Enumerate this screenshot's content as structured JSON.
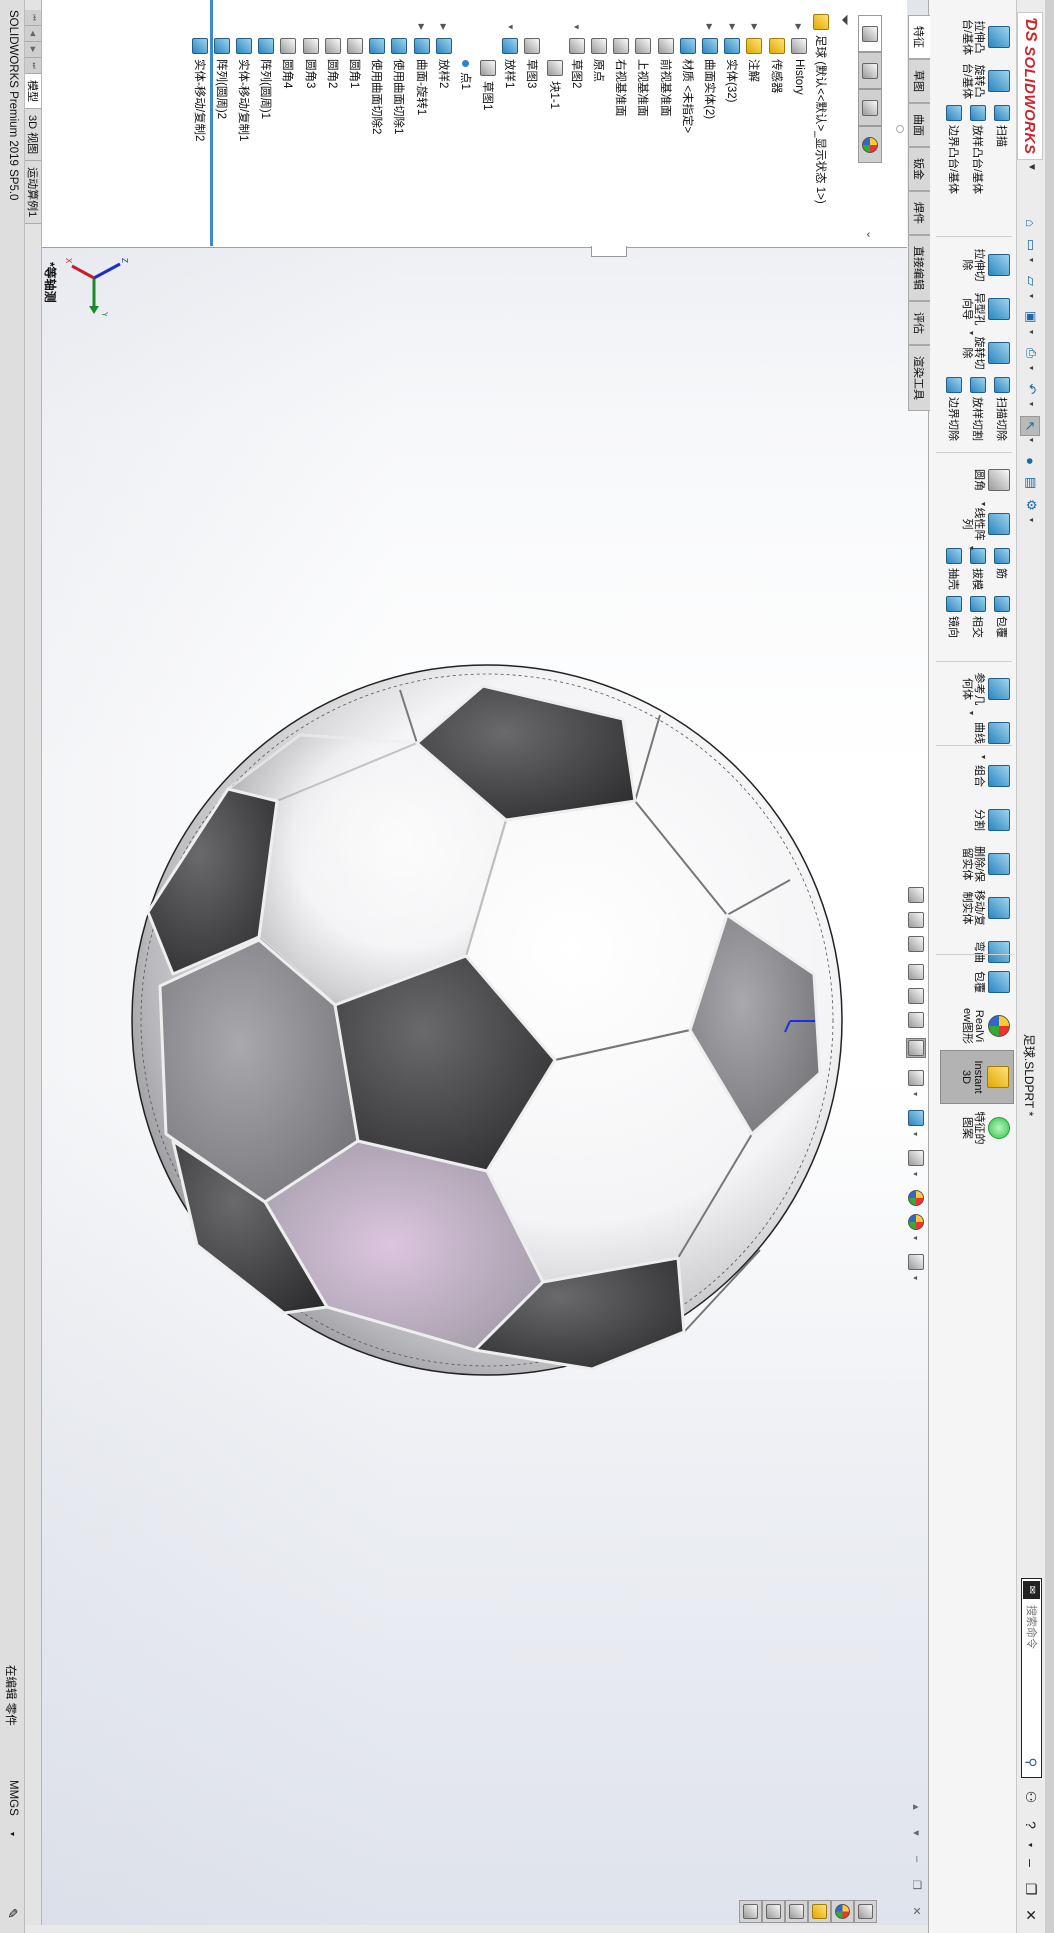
{
  "app": {
    "logo": "SOLIDWORKS",
    "title": "足球.SLDPRT *",
    "search_placeholder": "搜索命令",
    "status_product": "SOLIDWORKS Premium 2019 SP5.0",
    "status_mode": "在编辑 零件",
    "status_units": "MMGS",
    "view_name": "*等轴测"
  },
  "quick_access": [
    {
      "icon": "home-icon",
      "glyph": "⌂"
    },
    {
      "icon": "new-document-icon",
      "glyph": "▭",
      "dropdown": true
    },
    {
      "icon": "open-icon",
      "glyph": "▱",
      "dropdown": true
    },
    {
      "icon": "save-icon",
      "glyph": "▣",
      "dropdown": true
    },
    {
      "icon": "print-icon",
      "glyph": "⎙",
      "dropdown": true
    },
    {
      "icon": "undo-icon",
      "glyph": "↶",
      "dropdown": true
    },
    {
      "icon": "select-icon",
      "glyph": "↖",
      "dropdown": true,
      "selected": true
    },
    {
      "icon": "rebuild-icon",
      "glyph": "●"
    },
    {
      "icon": "file-properties-icon",
      "glyph": "▤"
    },
    {
      "icon": "options-gear-icon",
      "glyph": "⚙",
      "dropdown": true
    }
  ],
  "ribbon": {
    "groups": [
      {
        "items": [
          {
            "type": "large",
            "label": "拉伸凸台/基体",
            "icon": "extrude-boss-icon"
          },
          {
            "type": "large",
            "label": "旋转凸台/基体",
            "icon": "revolve-boss-icon"
          },
          {
            "type": "col",
            "items": [
              {
                "label": "扫描",
                "icon": "sweep-icon"
              },
              {
                "label": "放样凸台/基体",
                "icon": "loft-boss-icon"
              },
              {
                "label": "边界凸台/基体",
                "icon": "boundary-boss-icon"
              }
            ]
          }
        ]
      },
      {
        "items": [
          {
            "type": "large",
            "label": "拉伸切除",
            "icon": "extrude-cut-icon"
          },
          {
            "type": "large",
            "label": "异型孔向导",
            "icon": "hole-wizard-icon",
            "dropdown": true
          },
          {
            "type": "large",
            "label": "旋转切除",
            "icon": "revolve-cut-icon"
          },
          {
            "type": "col",
            "items": [
              {
                "label": "扫描切除",
                "icon": "swept-cut-icon"
              },
              {
                "label": "放样切割",
                "icon": "lofted-cut-icon"
              },
              {
                "label": "边界切除",
                "icon": "boundary-cut-icon"
              }
            ]
          }
        ]
      },
      {
        "items": [
          {
            "type": "large",
            "label": "圆角",
            "icon": "fillet-icon",
            "dropdown": true
          },
          {
            "type": "large",
            "label": "线性阵列",
            "icon": "linear-pattern-icon",
            "dropdown": true
          },
          {
            "type": "col",
            "items": [
              {
                "label": "筋",
                "icon": "rib-icon"
              },
              {
                "label": "拔模",
                "icon": "draft-icon"
              },
              {
                "label": "抽壳",
                "icon": "shell-icon"
              }
            ]
          },
          {
            "type": "col",
            "items": [
              {
                "label": "包覆",
                "icon": "wrap-icon"
              },
              {
                "label": "相交",
                "icon": "intersect-icon"
              },
              {
                "label": "镜向",
                "icon": "mirror-icon"
              }
            ]
          }
        ]
      },
      {
        "items": [
          {
            "type": "large",
            "label": "参考几何体",
            "icon": "reference-geometry-icon",
            "dropdown": true
          },
          {
            "type": "large",
            "label": "曲线",
            "icon": "curves-icon",
            "dropdown": true
          }
        ]
      },
      {
        "items": [
          {
            "type": "large",
            "label": "组合",
            "icon": "combine-icon"
          },
          {
            "type": "large",
            "label": "分割",
            "icon": "split-icon"
          },
          {
            "type": "large",
            "label": "删除/保留实体",
            "icon": "delete-keep-body-icon"
          },
          {
            "type": "large",
            "label": "移动/复制实体",
            "icon": "move-copy-body-icon"
          },
          {
            "type": "large",
            "label": "弯曲",
            "icon": "flex-icon"
          }
        ]
      },
      {
        "items": [
          {
            "type": "large",
            "label": "包覆",
            "icon": "wrap-icon"
          },
          {
            "type": "large",
            "label": "RealView图形",
            "icon": "realview-icon"
          },
          {
            "type": "large",
            "label": "Instant3D",
            "icon": "instant3d-icon",
            "active": true
          },
          {
            "type": "large",
            "label": "特征的图案",
            "icon": "feature-pattern-icon"
          }
        ]
      }
    ]
  },
  "command_tabs": [
    {
      "label": "特征",
      "active": true
    },
    {
      "label": "草图"
    },
    {
      "label": "曲面"
    },
    {
      "label": "钣金"
    },
    {
      "label": "焊件"
    },
    {
      "label": "直接编辑"
    },
    {
      "label": "评估"
    },
    {
      "label": "渲染工具"
    }
  ],
  "feature_manager": {
    "tabs": [
      {
        "icon": "featuremanager-tree-icon",
        "active": true
      },
      {
        "icon": "propertymanager-icon"
      },
      {
        "icon": "configurationmanager-icon"
      },
      {
        "icon": "displaymanager-icon"
      }
    ],
    "tree": [
      {
        "label": "足球  (默认<<默认>_显示状态 1>)",
        "icon": "part-icon",
        "level": 0
      },
      {
        "label": "History",
        "icon": "history-icon",
        "level": 1,
        "expander": "collapsed"
      },
      {
        "label": "传感器",
        "icon": "sensor-icon",
        "level": 1
      },
      {
        "label": "注解",
        "icon": "annotations-icon",
        "level": 1,
        "expander": "collapsed"
      },
      {
        "label": "实体(32)",
        "icon": "solid-bodies-icon",
        "level": 1,
        "expander": "collapsed"
      },
      {
        "label": "曲面实体(2)",
        "icon": "surface-bodies-icon",
        "level": 1,
        "expander": "collapsed"
      },
      {
        "label": "材质 <未指定>",
        "icon": "material-icon",
        "level": 1
      },
      {
        "label": "前视基准面",
        "icon": "plane-icon",
        "level": 1
      },
      {
        "label": "上视基准面",
        "icon": "plane-icon",
        "level": 1
      },
      {
        "label": "右视基准面",
        "icon": "plane-icon",
        "level": 1
      },
      {
        "label": "原点",
        "icon": "origin-icon",
        "level": 1
      },
      {
        "label": "草图2",
        "icon": "sketch-icon",
        "level": 1,
        "expander": "expanded"
      },
      {
        "label": "块1-1",
        "icon": "block-icon",
        "level": 2
      },
      {
        "label": "草图3",
        "icon": "sketch-icon",
        "level": 1
      },
      {
        "label": "放样1",
        "icon": "loft-icon",
        "level": 1,
        "expander": "expanded"
      },
      {
        "label": "草图1",
        "icon": "sketch-icon",
        "level": 2
      },
      {
        "label": "点1",
        "icon": "point-icon",
        "level": 2
      },
      {
        "label": "放样2",
        "icon": "loft-icon",
        "level": 1,
        "expander": "collapsed"
      },
      {
        "label": "曲面-旋转1",
        "icon": "surface-revolve-icon",
        "level": 1,
        "expander": "collapsed"
      },
      {
        "label": "使用曲面切除1",
        "icon": "surface-cut-icon",
        "level": 1
      },
      {
        "label": "使用曲面切除2",
        "icon": "surface-cut-icon",
        "level": 1
      },
      {
        "label": "圆角1",
        "icon": "fillet-icon",
        "level": 1
      },
      {
        "label": "圆角2",
        "icon": "fillet-icon",
        "level": 1
      },
      {
        "label": "圆角3",
        "icon": "fillet-icon",
        "level": 1
      },
      {
        "label": "圆角4",
        "icon": "fillet-icon",
        "level": 1
      },
      {
        "label": "阵列(圆周)1",
        "icon": "circular-pattern-icon",
        "level": 1
      },
      {
        "label": "实体-移动/复制1",
        "icon": "move-copy-body-icon",
        "level": 1
      },
      {
        "label": "阵列(圆周)2",
        "icon": "circular-pattern-icon",
        "level": 1
      },
      {
        "label": "实体-移动/复制2",
        "icon": "move-copy-body-icon",
        "level": 1
      }
    ]
  },
  "model_tabs": [
    {
      "label": "模型",
      "active": true
    },
    {
      "label": "3D 视图"
    },
    {
      "label": "运动算例1"
    }
  ],
  "heads_up_toolbar": [
    {
      "icon": "zoom-to-fit-icon"
    },
    {
      "icon": "zoom-to-area-icon"
    },
    {
      "icon": "previous-view-icon"
    },
    {
      "icon": "section-view-icon"
    },
    {
      "icon": "dynamic-annotation-views-icon"
    },
    {
      "icon": "view-orientation-icon"
    },
    {
      "icon": "isometric-view-icon",
      "selected": true
    },
    {
      "icon": "view-orientation-cube-icon",
      "dropdown": true
    },
    {
      "icon": "display-style-icon",
      "dropdown": true
    },
    {
      "icon": "hide-show-items-icon",
      "dropdown": true
    },
    {
      "icon": "edit-appearance-icon"
    },
    {
      "icon": "apply-scene-icon",
      "dropdown": true
    },
    {
      "icon": "view-settings-icon",
      "dropdown": true
    }
  ],
  "task_pane": [
    {
      "icon": "solidworks-resources-icon"
    },
    {
      "icon": "appearances-scenes-icon"
    },
    {
      "icon": "file-explorer-icon"
    },
    {
      "icon": "design-library-icon"
    },
    {
      "icon": "view-palette-icon"
    },
    {
      "icon": "custom-properties-icon"
    }
  ],
  "colors": {
    "accent_blue": "#2b86bf",
    "brand_red": "#d2232a",
    "panel_dark": "#3e3e3e",
    "panel_mid": "#8a8a8a",
    "panel_lilac": "#d9c4dc"
  }
}
